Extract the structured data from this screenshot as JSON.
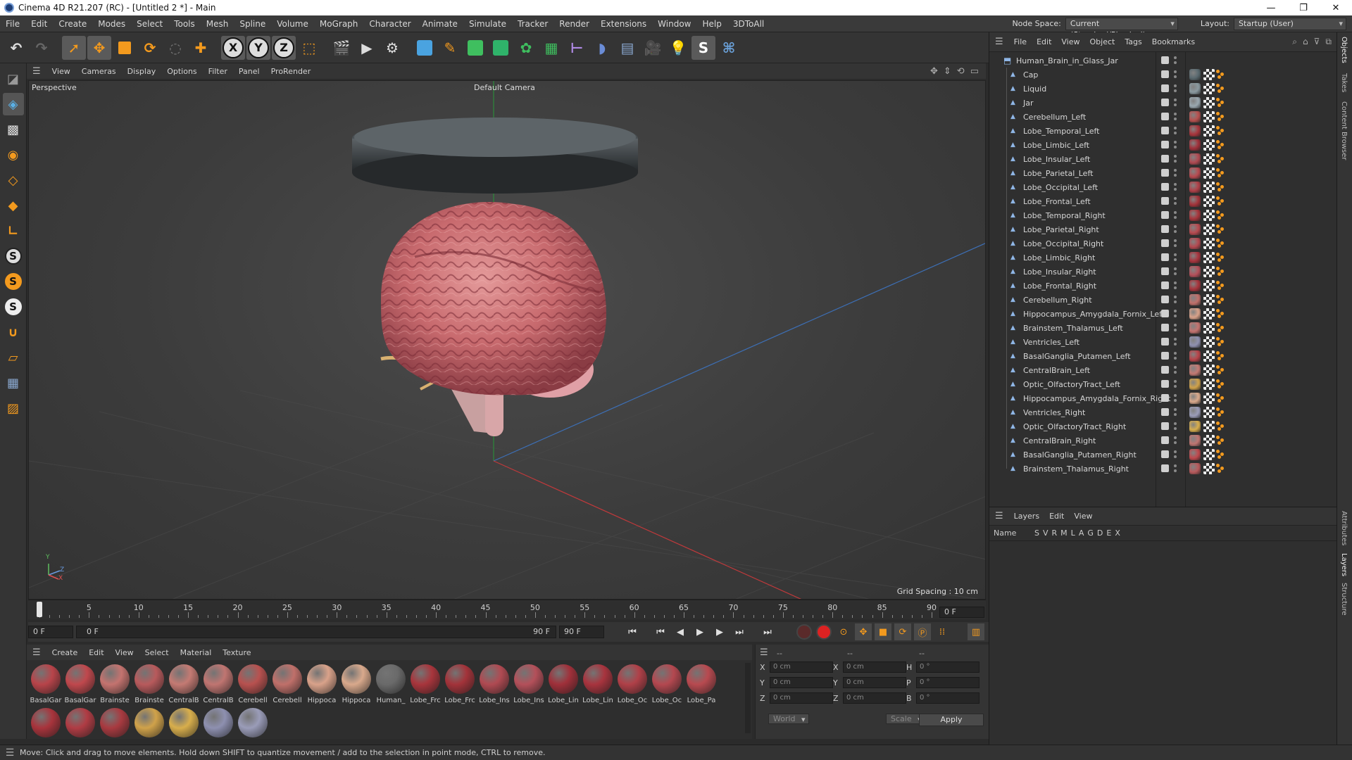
{
  "titlebar": {
    "title": "Cinema 4D R21.207 (RC) - [Untitled 2 *] - Main",
    "minimize": "—",
    "maximize": "❐",
    "close": "✕"
  },
  "menubar": {
    "items": [
      "File",
      "Edit",
      "Create",
      "Modes",
      "Select",
      "Tools",
      "Mesh",
      "Spline",
      "Volume",
      "MoGraph",
      "Character",
      "Animate",
      "Simulate",
      "Tracker",
      "Render",
      "Extensions",
      "Window",
      "Help",
      "3DToAll"
    ],
    "node_space_label": "Node Space:",
    "node_space_value": "Current (Standard/Physical)",
    "layout_label": "Layout:",
    "layout_value": "Startup (User)"
  },
  "toolbar": {
    "x": "X",
    "y": "Y",
    "z": "Z"
  },
  "lefttools": {
    "s1": "S",
    "s2": "S",
    "s3": "S"
  },
  "viewport_menu": {
    "items": [
      "View",
      "Cameras",
      "Display",
      "Options",
      "Filter",
      "Panel",
      "ProRender"
    ]
  },
  "viewport": {
    "view_name": "Perspective",
    "camera": "Default Camera",
    "grid_spacing": "Grid Spacing : 10 cm",
    "axis_y": "Y",
    "axis_z": "Z",
    "axis_x": "X"
  },
  "timeline": {
    "ticks": [
      "0",
      "5",
      "10",
      "15",
      "20",
      "25",
      "30",
      "35",
      "40",
      "45",
      "50",
      "55",
      "60",
      "65",
      "70",
      "75",
      "80",
      "85",
      "90"
    ],
    "current_frame": "0 F"
  },
  "playbar": {
    "start_frame": "0 F",
    "range_start": "0 F",
    "range_end": "90 F",
    "end_frame": "90 F"
  },
  "material_menu": {
    "items": [
      "Create",
      "Edit",
      "View",
      "Select",
      "Material",
      "Texture"
    ]
  },
  "materials": [
    {
      "label": "BasalGar",
      "color": "#b8444a"
    },
    {
      "label": "BasalGar",
      "color": "#c0484d"
    },
    {
      "label": "Brainste",
      "color": "#c4736f"
    },
    {
      "label": "Brainste",
      "color": "#b85a5c"
    },
    {
      "label": "CentralB",
      "color": "#c47a73"
    },
    {
      "label": "CentralB",
      "color": "#c07571"
    },
    {
      "label": "Cerebell",
      "color": "#b8514f"
    },
    {
      "label": "Cerebell",
      "color": "#c0706a"
    },
    {
      "label": "Hippoca",
      "color": "#d9a28a"
    },
    {
      "label": "Hippoca",
      "color": "#d9a98c"
    },
    {
      "label": "Human_",
      "color": "#6a6a6a"
    },
    {
      "label": "Lobe_Frc",
      "color": "#a8353c"
    },
    {
      "label": "Lobe_Frc",
      "color": "#a3333a"
    },
    {
      "label": "Lobe_Ins",
      "color": "#b04a52"
    },
    {
      "label": "Lobe_Ins",
      "color": "#b4505a"
    },
    {
      "label": "Lobe_Lin",
      "color": "#a0303a"
    },
    {
      "label": "Lobe_Lin",
      "color": "#a8343e"
    },
    {
      "label": "Lobe_Oc",
      "color": "#b04048"
    },
    {
      "label": "Lobe_Oc",
      "color": "#b44850"
    },
    {
      "label": "Lobe_Pa",
      "color": "#b84a50"
    },
    {
      "label": "",
      "color": "#a8343c"
    },
    {
      "label": "",
      "color": "#b03c44"
    },
    {
      "label": "",
      "color": "#a83a40"
    },
    {
      "label": "",
      "color": "#d0a24a"
    },
    {
      "label": "",
      "color": "#d8ae4c"
    },
    {
      "label": "",
      "color": "#8e90b0"
    },
    {
      "label": "",
      "color": "#9a9cb8"
    }
  ],
  "coord": {
    "hdr1": "--",
    "hdr2": "--",
    "hdr3": "--",
    "rows": [
      {
        "a": "X",
        "av": "0 cm",
        "b": "X",
        "bv": "0 cm",
        "c": "H",
        "cv": "0 °"
      },
      {
        "a": "Y",
        "av": "0 cm",
        "b": "Y",
        "bv": "0 cm",
        "c": "P",
        "cv": "0 °"
      },
      {
        "a": "Z",
        "av": "0 cm",
        "b": "Z",
        "bv": "0 cm",
        "c": "B",
        "cv": "0 °"
      }
    ],
    "world": "World",
    "scale": "Scale",
    "apply": "Apply"
  },
  "status": "Move: Click and drag to move elements. Hold down SHIFT to quantize movement / add to the selection in point mode, CTRL to remove.",
  "object_manager": {
    "menu": [
      "File",
      "Edit",
      "View",
      "Object",
      "Tags",
      "Bookmarks"
    ],
    "root": "Human_Brain_in_Glass_Jar",
    "objects": [
      {
        "name": "Cap",
        "mat": "#5a6a70"
      },
      {
        "name": "Liquid",
        "mat": "#8a9aa0"
      },
      {
        "name": "Jar",
        "mat": "#9aa8b0"
      },
      {
        "name": "Cerebellum_Left",
        "mat": "#b8514f"
      },
      {
        "name": "Lobe_Temporal_Left",
        "mat": "#a8353c"
      },
      {
        "name": "Lobe_Limbic_Left",
        "mat": "#a0303a"
      },
      {
        "name": "Lobe_Insular_Left",
        "mat": "#b04a52"
      },
      {
        "name": "Lobe_Parietal_Left",
        "mat": "#b84a50"
      },
      {
        "name": "Lobe_Occipital_Left",
        "mat": "#b04048"
      },
      {
        "name": "Lobe_Frontal_Left",
        "mat": "#a3333a"
      },
      {
        "name": "Lobe_Temporal_Right",
        "mat": "#a8353c"
      },
      {
        "name": "Lobe_Parietal_Right",
        "mat": "#b84a50"
      },
      {
        "name": "Lobe_Occipital_Right",
        "mat": "#b44850"
      },
      {
        "name": "Lobe_Limbic_Right",
        "mat": "#a8343e"
      },
      {
        "name": "Lobe_Insular_Right",
        "mat": "#b4505a"
      },
      {
        "name": "Lobe_Frontal_Right",
        "mat": "#a8343c"
      },
      {
        "name": "Cerebellum_Right",
        "mat": "#c0706a"
      },
      {
        "name": "Hippocampus_Amygdala_Fornix_Left",
        "mat": "#d9a28a"
      },
      {
        "name": "Brainstem_Thalamus_Left",
        "mat": "#c4736f"
      },
      {
        "name": "Ventricles_Left",
        "mat": "#8e90b0"
      },
      {
        "name": "BasalGanglia_Putamen_Left",
        "mat": "#b8444a"
      },
      {
        "name": "CentralBrain_Left",
        "mat": "#c47a73"
      },
      {
        "name": "Optic_OlfactoryTract_Left",
        "mat": "#d0a24a"
      },
      {
        "name": "Hippocampus_Amygdala_Fornix_Right",
        "mat": "#d9a98c"
      },
      {
        "name": "Ventricles_Right",
        "mat": "#9a9cb8"
      },
      {
        "name": "Optic_OlfactoryTract_Right",
        "mat": "#d8ae4c"
      },
      {
        "name": "CentralBrain_Right",
        "mat": "#c07571"
      },
      {
        "name": "BasalGanglia_Putamen_Right",
        "mat": "#c0484d"
      },
      {
        "name": "Brainstem_Thalamus_Right",
        "mat": "#b85a5c"
      }
    ]
  },
  "layer_manager": {
    "menu": [
      "Layers",
      "Edit",
      "View"
    ],
    "name_col": "Name",
    "cols": [
      "S",
      "V",
      "R",
      "M",
      "L",
      "A",
      "G",
      "D",
      "E",
      "X"
    ]
  },
  "side_tabs": [
    "Objects",
    "Takes",
    "Content Browser",
    "Attributes",
    "Layers",
    "Structure"
  ],
  "colors": {
    "accent": "#f39a1e",
    "grid_red": "#c0393b",
    "grid_green": "#2c8a3a",
    "grid_blue": "#3d6fb5"
  }
}
